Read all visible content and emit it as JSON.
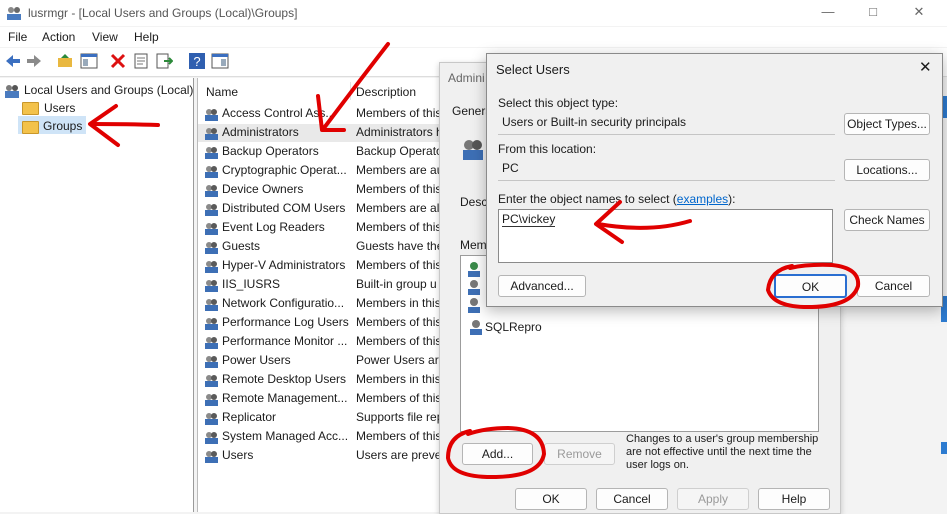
{
  "window": {
    "title": "lusrmgr - [Local Users and Groups (Local)\\Groups]"
  },
  "menu": [
    "File",
    "Action",
    "View",
    "Help"
  ],
  "tree": {
    "root": "Local Users and Groups (Local)",
    "children": [
      "Users",
      "Groups"
    ],
    "selected": "Groups"
  },
  "list": {
    "headers": {
      "name": "Name",
      "description": "Description"
    },
    "rows": [
      {
        "name": "Access Control Ass...",
        "desc": "Members of this"
      },
      {
        "name": "Administrators",
        "desc": "Administrators h"
      },
      {
        "name": "Backup Operators",
        "desc": "Backup Operato"
      },
      {
        "name": "Cryptographic Operat...",
        "desc": "Members are au"
      },
      {
        "name": "Device Owners",
        "desc": "Members of this"
      },
      {
        "name": "Distributed COM Users",
        "desc": "Members are all"
      },
      {
        "name": "Event Log Readers",
        "desc": "Members of this"
      },
      {
        "name": "Guests",
        "desc": "Guests have the"
      },
      {
        "name": "Hyper-V Administrators",
        "desc": "Members of this"
      },
      {
        "name": "IIS_IUSRS",
        "desc": "Built-in group u"
      },
      {
        "name": "Network Configuratio...",
        "desc": "Members in this"
      },
      {
        "name": "Performance Log Users",
        "desc": "Members of this"
      },
      {
        "name": "Performance Monitor ...",
        "desc": "Members of this"
      },
      {
        "name": "Power Users",
        "desc": "Power Users are"
      },
      {
        "name": "Remote Desktop Users",
        "desc": "Members in this"
      },
      {
        "name": "Remote Management...",
        "desc": "Members of this"
      },
      {
        "name": "Replicator",
        "desc": "Supports file rep"
      },
      {
        "name": "System Managed Acc...",
        "desc": "Members of this"
      },
      {
        "name": "Users",
        "desc": "Users are prever"
      }
    ]
  },
  "props_dialog": {
    "title_partial": "Admini",
    "tab_partial": "Genera",
    "desc_partial": "Desc",
    "members_partial": "Memb",
    "member_visible": "SQLRepro",
    "note": "Changes to a user's group membership are not effective until the next time the user logs on.",
    "buttons": {
      "add": "Add...",
      "remove": "Remove",
      "ok": "OK",
      "cancel": "Cancel",
      "apply": "Apply",
      "help": "Help"
    }
  },
  "select_users": {
    "title": "Select Users",
    "object_type_label": "Select this object type:",
    "object_type_value": "Users or Built-in security principals",
    "object_types_button": "Object Types...",
    "location_label": "From this location:",
    "location_value": "PC",
    "locations_button": "Locations...",
    "enter_label_prefix": "Enter the object names to select (",
    "enter_label_link": "examples",
    "enter_label_suffix": "):",
    "names_value": "PC\\vickey",
    "check_names_button": "Check Names",
    "advanced_button": "Advanced...",
    "ok_button": "OK",
    "cancel_button": "Cancel"
  }
}
